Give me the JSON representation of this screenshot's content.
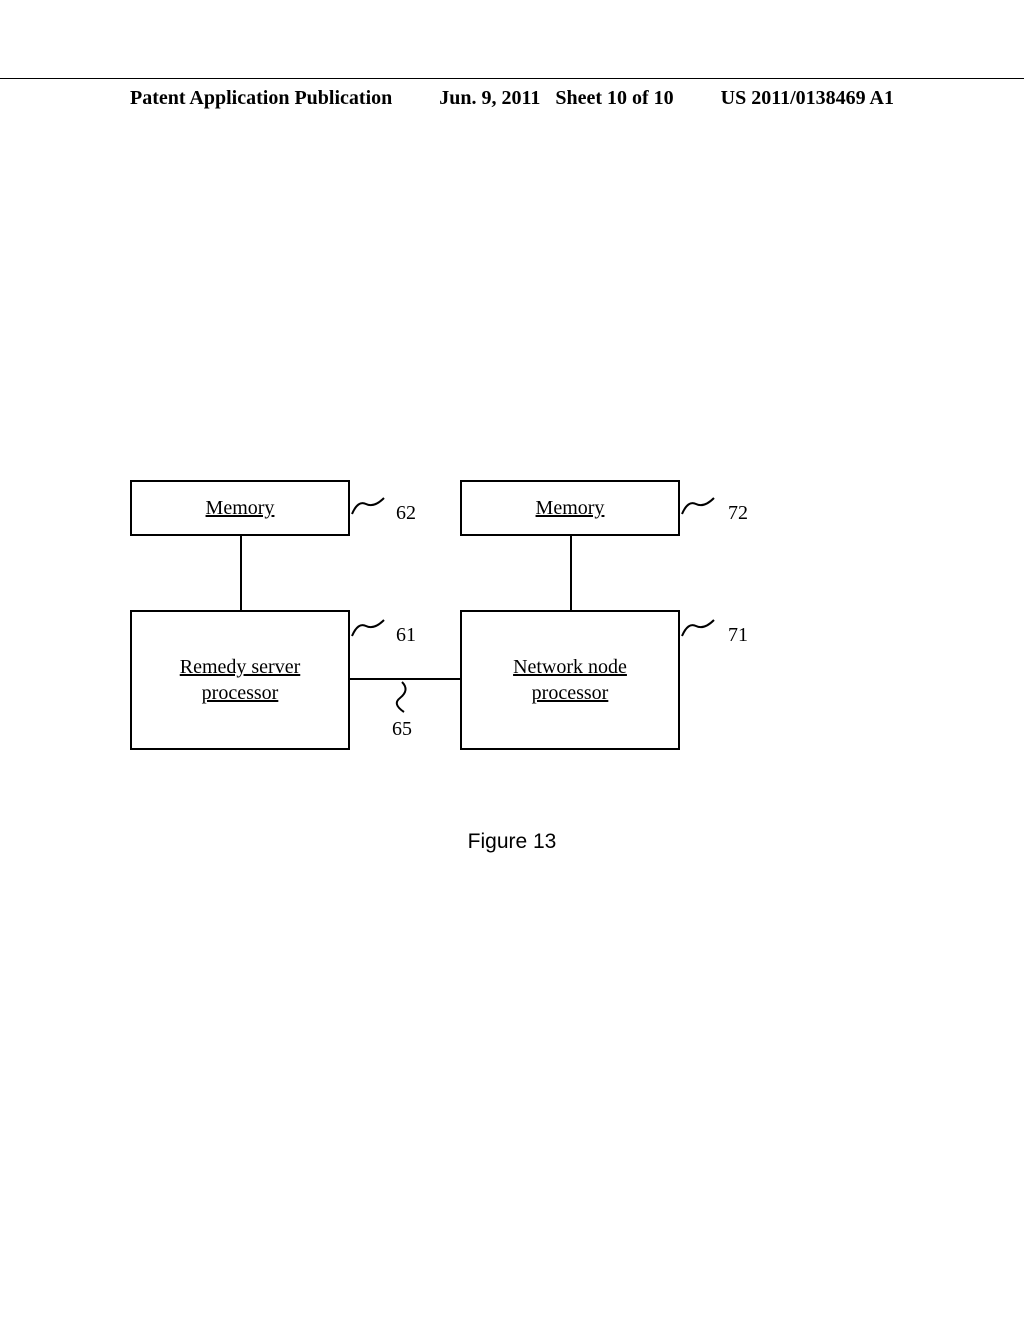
{
  "header": {
    "left": "Patent Application Publication",
    "date": "Jun. 9, 2011",
    "sheet": "Sheet 10 of 10",
    "pubno": "US 2011/0138469 A1"
  },
  "diagram": {
    "memory_left": "Memory",
    "memory_right": "Memory",
    "processor_left_line1": "Remedy server",
    "processor_left_line2": "processor",
    "processor_right_line1": "Network node",
    "processor_right_line2": "processor",
    "ref_mem_left": "62",
    "ref_mem_right": "72",
    "ref_proc_left": "61",
    "ref_proc_right": "71",
    "ref_link": "65"
  },
  "caption": "Figure 13"
}
